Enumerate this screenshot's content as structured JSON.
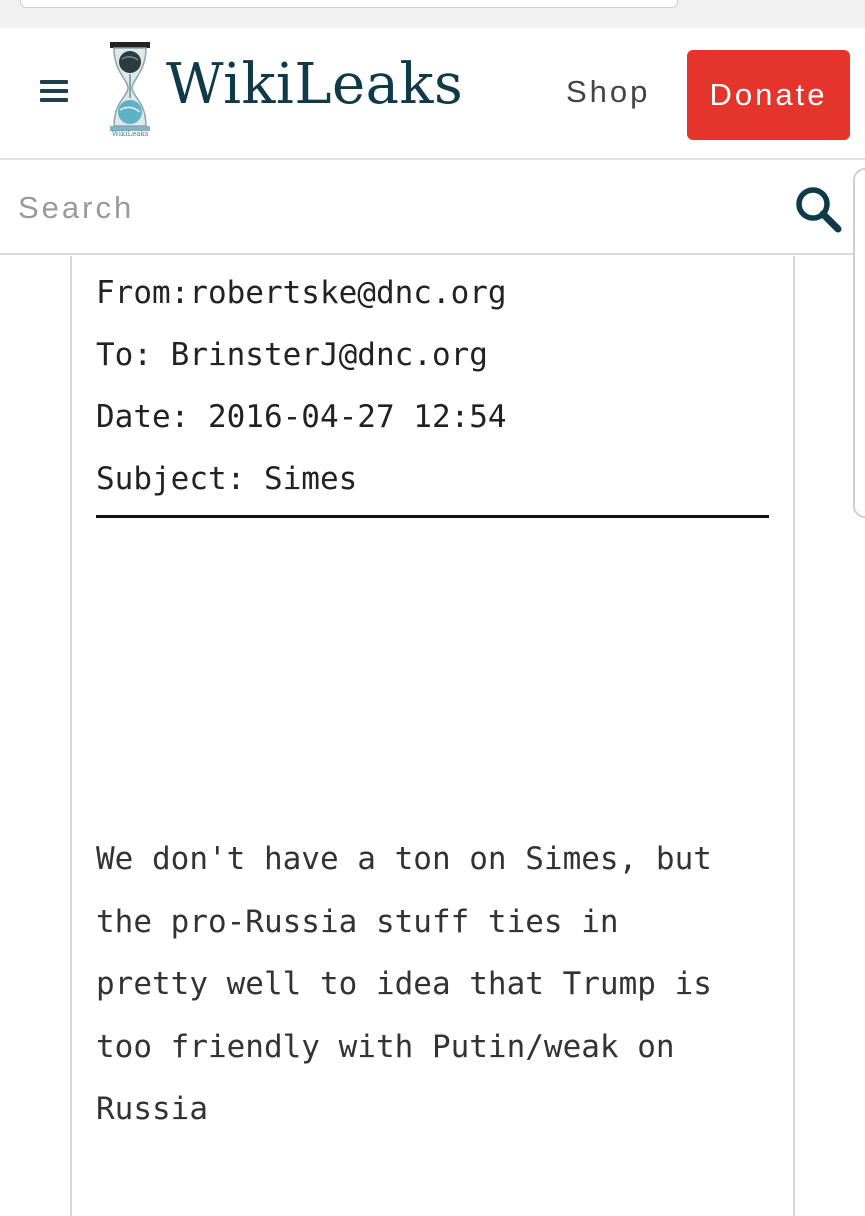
{
  "header": {
    "site_name": "WikiLeaks",
    "logo_text": "WikiLeaks",
    "shop_label": "Shop",
    "donate_label": "Donate",
    "colors": {
      "brand": "#0f3a48",
      "donate": "#e4342c"
    }
  },
  "search": {
    "placeholder": "Search"
  },
  "email": {
    "from": "From:robertske@dnc.org",
    "to": "To: BrinsterJ@dnc.org",
    "date": "Date: 2016-04-27 12:54",
    "subject": "Subject: Simes",
    "body_lines": [
      "We don't have a ton on Simes, but",
      "the pro-Russia stuff ties in",
      "pretty well to idea that Trump is",
      "too friendly with Putin/weak on",
      "Russia"
    ]
  },
  "icons": {
    "menu": "hamburger-menu-icon",
    "search": "search-icon",
    "logo": "hourglass-globe-logo"
  }
}
